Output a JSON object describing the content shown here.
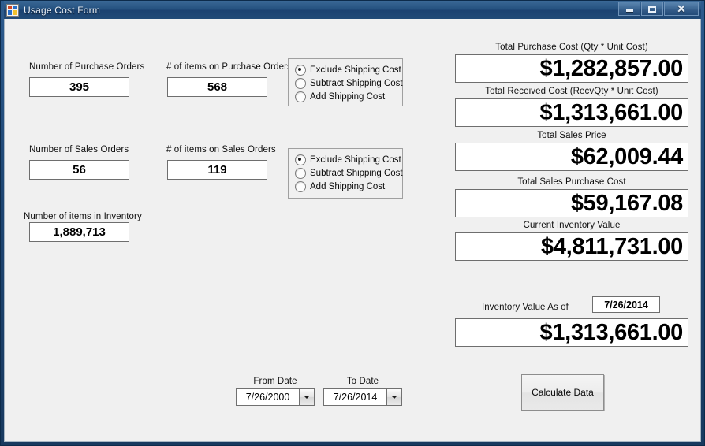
{
  "window": {
    "title": "Usage Cost Form",
    "icon": "form-icon",
    "buttons": {
      "minimize": "minimize-icon",
      "maximize": "maximize-icon",
      "close": "✕"
    }
  },
  "left": {
    "purchase_orders_label": "Number of Purchase Orders",
    "purchase_orders_value": "395",
    "purchase_items_label": "# of items on Purchase Orders",
    "purchase_items_value": "568",
    "sales_orders_label": "Number of Sales Orders",
    "sales_orders_value": "56",
    "sales_items_label": "# of items on Sales Orders",
    "sales_items_value": "119",
    "inventory_items_label": "Number of items in Inventory",
    "inventory_items_value": "1,889,713"
  },
  "shipping_options": {
    "purchase_group": [
      {
        "label": "Exclude Shipping Cost",
        "selected": true
      },
      {
        "label": "Subtract Shipping Cost",
        "selected": false
      },
      {
        "label": "Add Shipping Cost",
        "selected": false
      }
    ],
    "sales_group": [
      {
        "label": "Exclude Shipping Cost",
        "selected": true
      },
      {
        "label": "Subtract Shipping Cost",
        "selected": false
      },
      {
        "label": "Add Shipping Cost",
        "selected": false
      }
    ]
  },
  "right": {
    "total_purchase_cost_label": "Total Purchase Cost  (Qty * Unit Cost)",
    "total_purchase_cost_value": "$1,282,857.00",
    "total_received_cost_label": "Total Received Cost  (RecvQty * Unit Cost)",
    "total_received_cost_value": "$1,313,661.00",
    "total_sales_price_label": "Total Sales Price",
    "total_sales_price_value": "$62,009.44",
    "total_sales_purchase_cost_label": "Total Sales Purchase Cost",
    "total_sales_purchase_cost_value": "$59,167.08",
    "current_inventory_value_label": "Current Inventory Value",
    "current_inventory_value_value": "$4,811,731.00",
    "inventory_asof_label": "Inventory Value As of",
    "inventory_asof_date": "7/26/2014",
    "inventory_asof_value": "$1,313,661.00"
  },
  "footer": {
    "from_date_label": "From Date",
    "from_date_value": "7/26/2000",
    "to_date_label": "To Date",
    "to_date_value": "7/26/2014",
    "calculate_button": "Calculate Data"
  },
  "colors": {
    "title_bar": "#1d4572",
    "client_bg": "#f0f0f0",
    "field_border": "#6e6e6e"
  }
}
